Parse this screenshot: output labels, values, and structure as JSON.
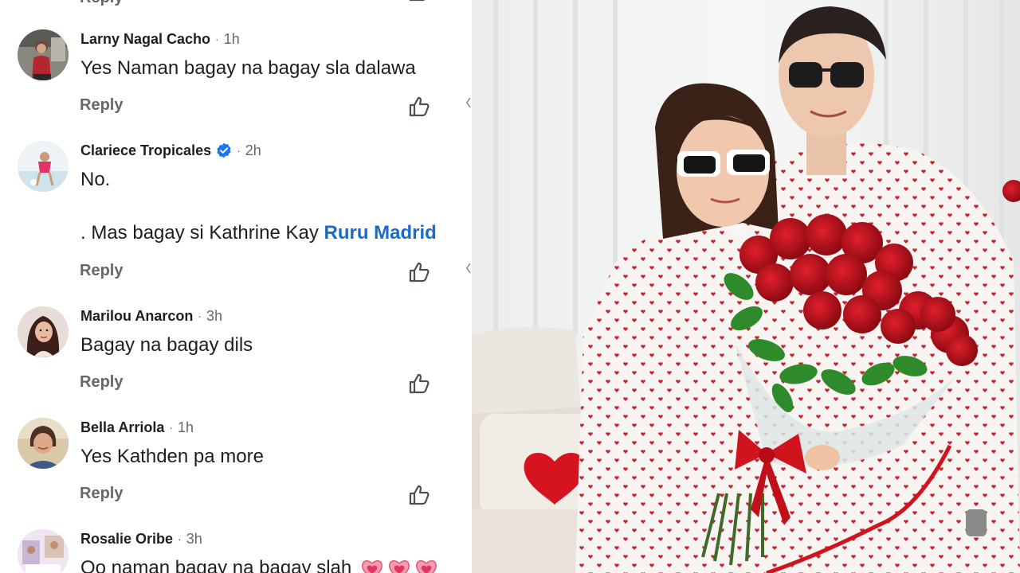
{
  "comments": [
    {
      "author": "Larny Nagal Cacho",
      "time": "1h",
      "text": "Yes Naman bagay na bagay sla dalawa",
      "reply_label": "Reply"
    },
    {
      "author": "Clariece Tropicales",
      "verified": true,
      "time": "2h",
      "text_line1": "No.",
      "text_line2_prefix": ". Mas bagay si Kathrine Kay ",
      "mention": "Ruru Madrid",
      "reply_label": "Reply"
    },
    {
      "author": "Marilou Anarcon",
      "time": "3h",
      "text": "Bagay na bagay dils",
      "reply_label": "Reply"
    },
    {
      "author": "Bella Arriola",
      "time": "1h",
      "text": "Yes Kathden pa more",
      "reply_label": "Reply"
    },
    {
      "author": "Rosalie Oribe",
      "time": "3h",
      "text": "Oo naman bagay na bagay slah",
      "emoji": [
        "heart-emoji",
        "heart-emoji",
        "heart-emoji"
      ]
    }
  ],
  "top_reply_label": "Reply",
  "separator": "·",
  "icons": {
    "like": "thumbs-up-icon",
    "verified": "verified-badge-icon"
  },
  "colors": {
    "author": "#1c1e21",
    "meta": "#65676b",
    "mention": "#1b6ac9",
    "verified": "#1877f2",
    "roses": "#c8101a"
  }
}
